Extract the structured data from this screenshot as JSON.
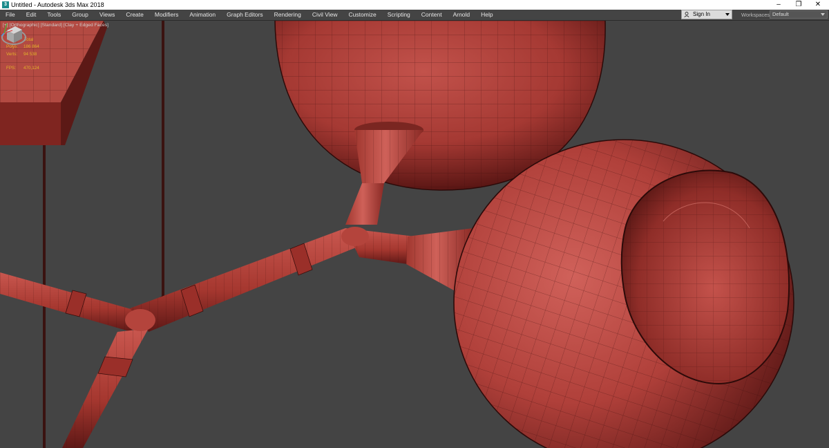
{
  "titlebar": {
    "title": "Untitled - Autodesk 3ds Max 2018",
    "app_icon": "3ds-max-icon",
    "minimize": "–",
    "restore": "❐",
    "close": "✕"
  },
  "menu": [
    "File",
    "Edit",
    "Tools",
    "Group",
    "Views",
    "Create",
    "Modifiers",
    "Animation",
    "Graph Editors",
    "Rendering",
    "Civil View",
    "Customize",
    "Scripting",
    "Content",
    "Arnold",
    "Help"
  ],
  "account": {
    "signin_label": "Sign In",
    "workspaces_label": "Workspaces:",
    "workspace_value": "Default"
  },
  "viewport": {
    "label": "[+] [Orthographic] [Standard] [Clay + Edged Faces]",
    "stats": {
      "total_label": "Total",
      "polys_label": "Polys:",
      "polys_value": "186 864",
      "verts_label": "Verts:",
      "verts_value": "94 538",
      "fps_label": "FPS:",
      "fps_value": "470,124"
    },
    "colors": {
      "background": "#444444",
      "clay": "#b8453f",
      "clay_dark": "#6e1e1b",
      "stats_text": "#e3b32a"
    },
    "icons": [
      "viewcube-icon",
      "axis-tripod-icon"
    ]
  }
}
